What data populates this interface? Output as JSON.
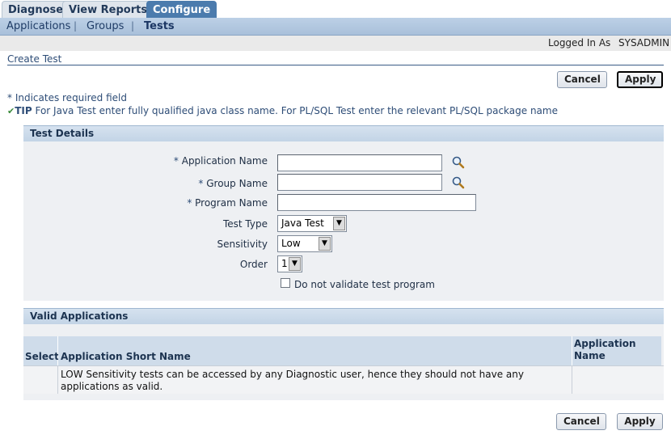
{
  "tabs": [
    {
      "label": "Diagnose",
      "active": false
    },
    {
      "label": "View Reports",
      "active": false
    },
    {
      "label": "Configure",
      "active": true
    }
  ],
  "subnav": [
    {
      "label": "Applications",
      "active": false
    },
    {
      "label": "Groups",
      "active": false
    },
    {
      "label": "Tests",
      "active": true
    }
  ],
  "login": {
    "label": "Logged In As",
    "user": "SYSADMIN"
  },
  "page_title": "Create Test",
  "buttons": {
    "cancel": "Cancel",
    "apply": "Apply"
  },
  "required_note": "* Indicates required field",
  "tip": {
    "label": "TIP",
    "text": " For Java Test enter fully qualified java class name. For PL/SQL Test enter the relevant PL/SQL package name"
  },
  "test_details": {
    "heading": "Test Details",
    "required_marker": "*",
    "application_name": {
      "label": "Application Name",
      "value": ""
    },
    "group_name": {
      "label": "Group Name",
      "value": ""
    },
    "program_name": {
      "label": "Program Name",
      "value": ""
    },
    "test_type": {
      "label": "Test Type",
      "value": "Java Test"
    },
    "sensitivity": {
      "label": "Sensitivity",
      "value": "Low"
    },
    "order": {
      "label": "Order",
      "value": "1"
    },
    "no_validate": {
      "label": "Do not validate test program",
      "checked": false
    }
  },
  "valid_applications": {
    "heading": "Valid Applications",
    "columns": [
      "Select",
      "Application Short Name",
      "Application Name"
    ],
    "message": "LOW Sensitivity tests can be accessed by any Diagnostic user, hence they should not have any applications as valid."
  },
  "colors": {
    "accent": "#4b7bad",
    "title": "#2e4d77",
    "section": "#c3d4e6"
  }
}
